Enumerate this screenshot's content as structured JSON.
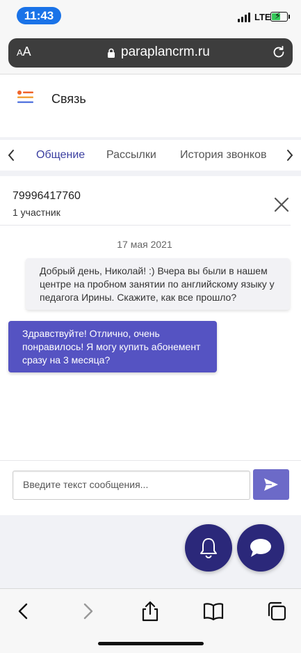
{
  "status_bar": {
    "time": "11:43",
    "network": "LTE"
  },
  "browser": {
    "text_size_label": "AA",
    "url": "paraplancrm.ru"
  },
  "app": {
    "title": "Связь"
  },
  "tabs": [
    {
      "label": "Общение",
      "active": true
    },
    {
      "label": "Рассылки",
      "active": false
    },
    {
      "label": "История звонков",
      "active": false
    }
  ],
  "conversation": {
    "phone": "79996417760",
    "participants": "1 участник",
    "date": "17 мая 2021",
    "messages": [
      {
        "direction": "incoming",
        "text": "Добрый день, Николай! :) Вчера вы были в нашем центре на пробном занятии по английскому языку у педагога Ирины. Скажите, как все прошло?"
      },
      {
        "direction": "outgoing",
        "text": "Здравствуйте! Отлично, очень понравилось! Я могу купить абонемент сразу на 3 месяца?"
      }
    ],
    "composer_placeholder": "Введите текст сообщения..."
  },
  "colors": {
    "accent": "#3b3fa0",
    "outgoing_bubble": "#5553c2",
    "send_button": "#6c6ac8",
    "fab": "#2b287a",
    "time_pill": "#1a73e8"
  },
  "icons": {
    "menu": "menu-lines-icon",
    "close": "close-icon",
    "send": "send-icon",
    "fab_left": "bell-icon",
    "fab_right": "chat-bubble-icon",
    "toolbar": [
      "back-icon",
      "forward-icon",
      "share-icon",
      "bookmarks-icon",
      "tabs-icon"
    ]
  }
}
